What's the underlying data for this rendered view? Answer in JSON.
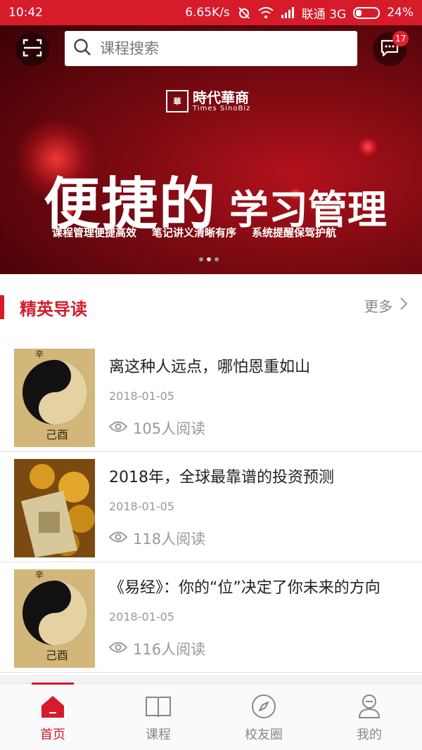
{
  "status_bar": {
    "time": "10:42",
    "speed": "6.65K/s",
    "carrier": "联通 3G",
    "battery": "24%"
  },
  "top_bar": {
    "search_placeholder": "课程搜索",
    "message_badge": "17"
  },
  "banner": {
    "logo_name": "時代華商",
    "logo_sub": "Times SinoBiz",
    "headline_big": "便捷的",
    "headline_small": "学习管理",
    "taglines": [
      "课程管理便捷高效",
      "笔记讲义清晰有序",
      "系统提醒保驾护航"
    ],
    "page_count": 3,
    "active_page": 1
  },
  "section": {
    "title": "精英导读",
    "more_label": "更多"
  },
  "articles": [
    {
      "title": "离这种人远点，哪怕恩重如山",
      "date": "2018-01-05",
      "reads": "105人阅读",
      "image": "yin-yang-scroll"
    },
    {
      "title": "2018年，全球最靠谱的投资预测",
      "date": "2018-01-05",
      "reads": "118人阅读",
      "image": "gold-and-dollars"
    },
    {
      "title": "《易经》：你的“位”决定了你未来的方向",
      "date": "2018-01-05",
      "reads": "116人阅读",
      "image": "yin-yang-scroll"
    }
  ],
  "tabs": [
    {
      "label": "首页",
      "icon": "home-icon",
      "active": true
    },
    {
      "label": "课程",
      "icon": "book-icon",
      "active": false
    },
    {
      "label": "校友圈",
      "icon": "compass-icon",
      "active": false
    },
    {
      "label": "我的",
      "icon": "profile-icon",
      "active": false
    }
  ],
  "colors": {
    "brand": "#d61b2b",
    "muted_text": "#999999"
  }
}
